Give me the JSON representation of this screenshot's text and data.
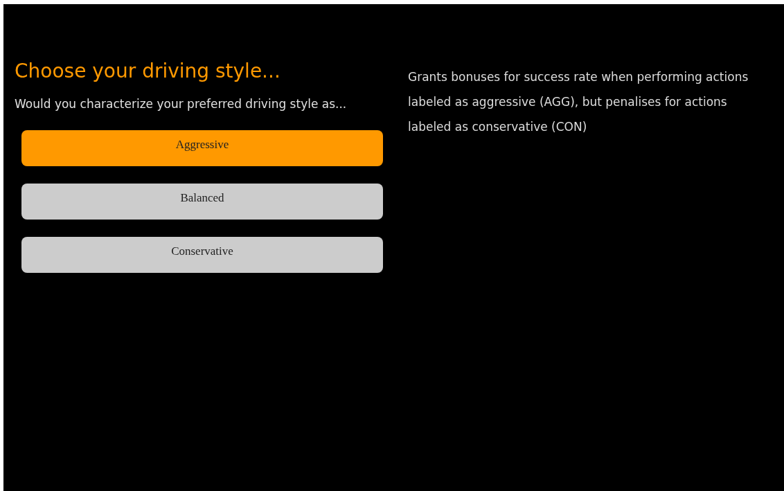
{
  "title": "Choose your driving style...",
  "question": "Would you characterize your preferred driving style as...",
  "options": [
    {
      "label": "Aggressive",
      "selected": true
    },
    {
      "label": "Balanced",
      "selected": false
    },
    {
      "label": "Conservative",
      "selected": false
    }
  ],
  "description": "Grants bonuses for success rate when performing actions labeled as aggressive (AGG), but penalises for actions labeled as conservative (CON)"
}
